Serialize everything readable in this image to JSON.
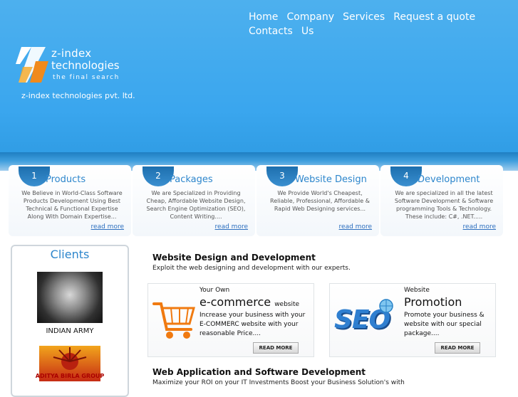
{
  "nav": {
    "items": [
      "Home",
      "Company",
      "Services",
      "Request a quote",
      "Contacts",
      "Us"
    ]
  },
  "logo": {
    "line1": "z-index",
    "line2": "technologies",
    "tagline": "the final search"
  },
  "company_name": "z-index technologies pvt. ltd.",
  "features": [
    {
      "num": "1",
      "title": "Products",
      "text": "We Believe in World-Class Software Products Development Using Best Technical & Functional Expertise Along With Domain Expertise...",
      "more": "read more"
    },
    {
      "num": "2",
      "title": "Packages",
      "text": "We are Specialized in Providing Cheap, Affordable Website Design, Search Engine Optimization (SEO), Content Writing....",
      "more": "read more"
    },
    {
      "num": "3",
      "title": "Website Design",
      "text": "We Provide World's Cheapest, Reliable, Professional, Affordable & Rapid Web Designing services...",
      "more": "read more"
    },
    {
      "num": "4",
      "title": "Development",
      "text": "We are specialized in all the latest Software Development & Software programming Tools & Technology. These include: C#, .NET.....",
      "more": "read more"
    }
  ],
  "clients": {
    "title": "Clients",
    "items": [
      "INDIAN ARMY",
      "ADITYA BIRLA GROUP"
    ]
  },
  "section1": {
    "title": "Website Design and Development",
    "subtitle": "Exploit the web designing and development with our experts."
  },
  "cards": [
    {
      "small": "Your Own",
      "big": "e-commerce",
      "big_suffix": "website",
      "desc": "Increase your business with your E-COMMERC website with your reasonable Price....",
      "button": "READ MORE"
    },
    {
      "small": "Website",
      "big": "Promotion",
      "big_suffix": "",
      "desc": "Promote your business & website with our special package....",
      "button": "READ MORE"
    }
  ],
  "seo_image_text": "SEO",
  "section2": {
    "title": "Web Application and Software Development",
    "subtitle": "Maximize your ROI on your IT Investments Boost your Business Solution's with"
  }
}
